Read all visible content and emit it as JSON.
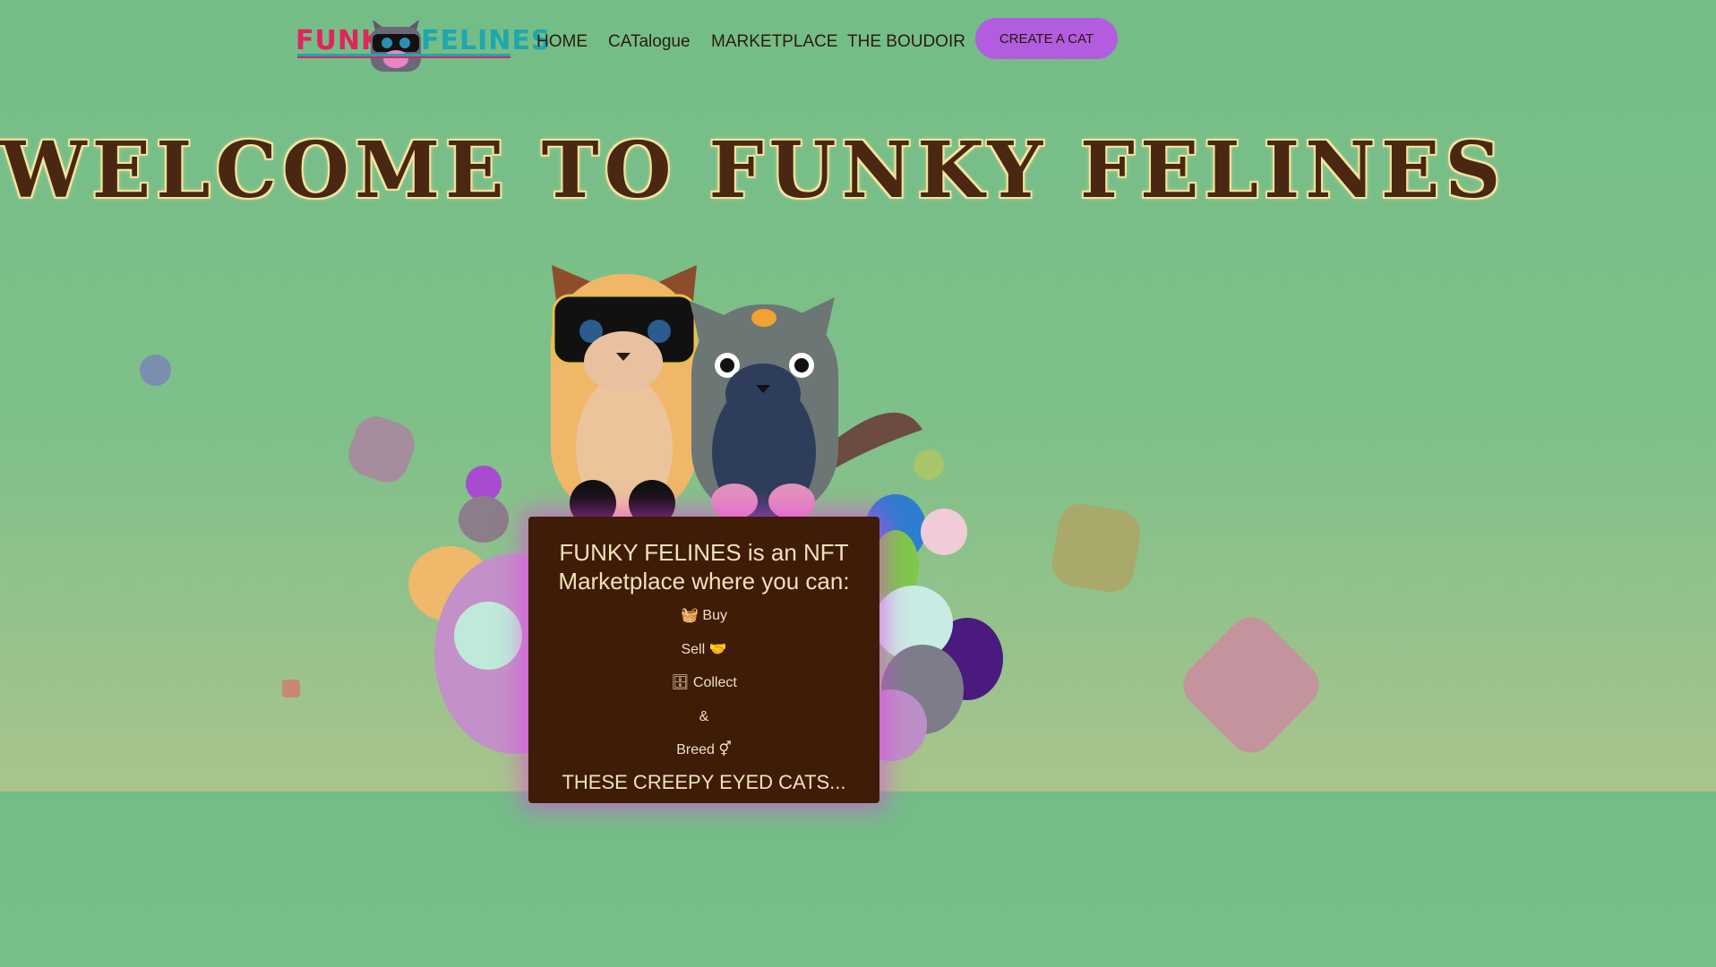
{
  "nav": {
    "logo_left": "FUNKY",
    "logo_right": "FELINES",
    "links": [
      "HOME",
      "CATalogue",
      "MARKETPLACE",
      "THE BOUDOIR"
    ],
    "cta": "CREATE A CAT"
  },
  "hero": {
    "title": "WELCOME TO FUNKY FELINES"
  },
  "card": {
    "heading": "FUNKY FELINES is an NFT Marketplace where you can:",
    "items": [
      {
        "label": "Buy",
        "icon": "basket-icon"
      },
      {
        "label": "Sell",
        "icon": "handshake-icon"
      },
      {
        "label": "Collect",
        "icon": "archive-icon"
      },
      {
        "label": "&"
      },
      {
        "label": "Breed",
        "icon": "gender-icon"
      }
    ],
    "footer": "THESE CREEPY EYED CATS..."
  },
  "colors": {
    "background": "#77bd86",
    "accent": "#b25de0",
    "card": "#3e1c08",
    "title": "#4a2710"
  }
}
